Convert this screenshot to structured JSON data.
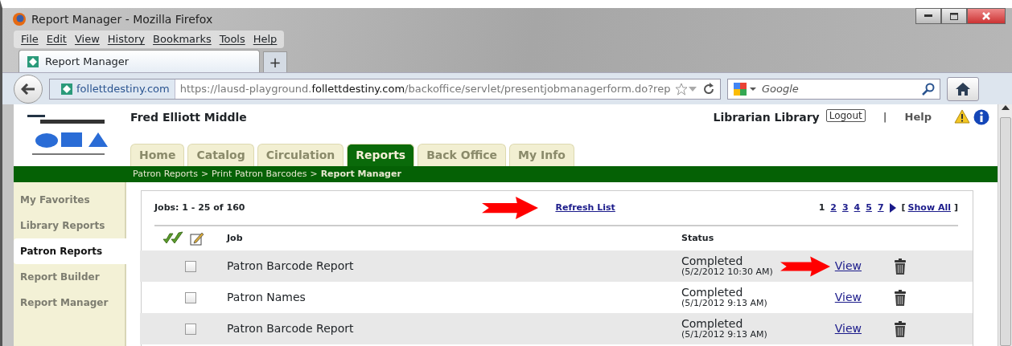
{
  "window": {
    "title": "Report Manager - Mozilla Firefox"
  },
  "menu": [
    "File",
    "Edit",
    "View",
    "History",
    "Bookmarks",
    "Tools",
    "Help"
  ],
  "browser_tabs": [
    {
      "label": "Report Manager",
      "selected": true
    }
  ],
  "new_tab": "+",
  "address_bar": {
    "site": "follettdestiny.com",
    "url_prefix": "https://lausd-playground.",
    "url_domain": "follettdestiny.com",
    "url_path": "/backoffice/servlet/presentjobmanagerform.do?rep"
  },
  "search": {
    "placeholder": "Google"
  },
  "header": {
    "school": "Fred Elliott Middle",
    "user": "Librarian Library",
    "logout": "Logout",
    "separator": "|",
    "help": "Help"
  },
  "tabs": [
    {
      "label": "Home",
      "selected": false
    },
    {
      "label": "Catalog",
      "selected": false
    },
    {
      "label": "Circulation",
      "selected": false
    },
    {
      "label": "Reports",
      "selected": true
    },
    {
      "label": "Back Office",
      "selected": false
    },
    {
      "label": "My Info",
      "selected": false
    }
  ],
  "breadcrumb": [
    {
      "label": "Patron Reports",
      "current": false
    },
    {
      "label": "Print Patron Barcodes",
      "current": false
    },
    {
      "label": "Report Manager",
      "current": true
    }
  ],
  "breadcrumb_separator": ">",
  "sidebar": {
    "items": [
      {
        "label": "My Favorites",
        "selected": false
      },
      {
        "label": "Library Reports",
        "selected": false
      },
      {
        "label": "Patron Reports",
        "selected": true
      },
      {
        "label": "Report Builder",
        "selected": false
      },
      {
        "label": "Report Manager",
        "selected": false
      }
    ]
  },
  "jobs": {
    "count": "Jobs: 1 - 25 of 160",
    "refresh": {
      "label": "Refresh List",
      "arrow": true
    },
    "pages": [
      {
        "label": "1",
        "selected": true
      },
      {
        "label": "2",
        "selected": false
      },
      {
        "label": "3",
        "selected": false
      },
      {
        "label": "4",
        "selected": false
      },
      {
        "label": "5",
        "selected": false
      },
      {
        "label": "7",
        "selected": false
      }
    ],
    "show_all": {
      "open": "[",
      "label": "Show All",
      "close": "]"
    },
    "columns": [
      "Job",
      "Status"
    ],
    "rows": [
      {
        "job": "Patron Barcode Report",
        "checked": false,
        "status": "Completed",
        "time": "(5/2/2012 10:30 AM)",
        "action": "View",
        "arrow": true
      },
      {
        "job": "Patron Names",
        "checked": false,
        "status": "Completed",
        "time": "(5/1/2012 9:13 AM)",
        "action": "View",
        "arrow": false
      },
      {
        "job": "Patron Barcode Report",
        "checked": false,
        "status": "Completed",
        "time": "(5/1/2012 9:13 AM)",
        "action": "View",
        "arrow": false
      }
    ]
  }
}
